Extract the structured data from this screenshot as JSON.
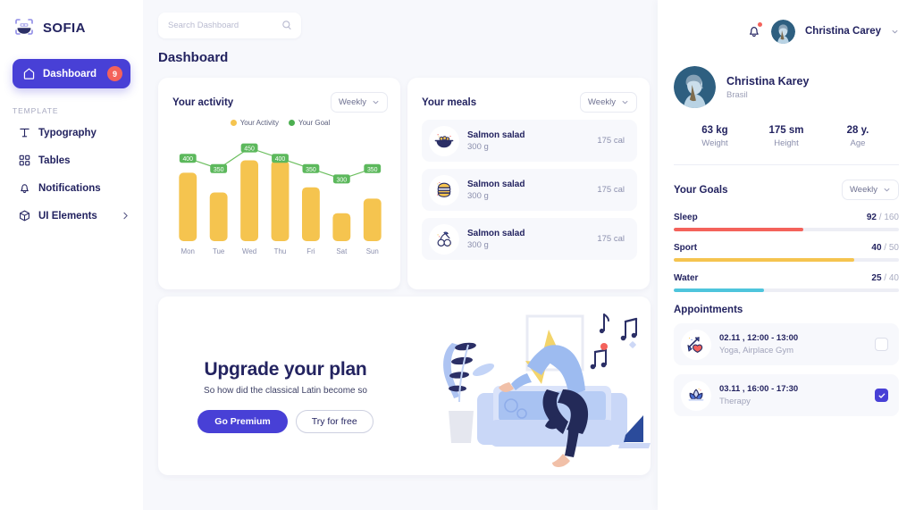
{
  "brand": {
    "name": "SOFIA",
    "logo_icon": "face-scan-icon"
  },
  "sidebar": {
    "active": {
      "label": "Dashboard",
      "badge": "9",
      "icon": "home-icon"
    },
    "section_label": "TEMPLATE",
    "items": [
      {
        "label": "Typography",
        "icon": "typography-icon"
      },
      {
        "label": "Tables",
        "icon": "tables-icon"
      },
      {
        "label": "Notifications",
        "icon": "bell-icon"
      },
      {
        "label": "UI Elements",
        "icon": "cube-icon",
        "chevron": "chevron-right-icon"
      }
    ]
  },
  "topbar": {
    "search_placeholder": "Search Dashboard",
    "search_value": "",
    "search_icon": "search-icon",
    "bell_icon": "bell-icon",
    "user_name": "Christina Carey",
    "chevron": "chevron-down-icon"
  },
  "page": {
    "title": "Dashboard"
  },
  "activity": {
    "title": "Your activity",
    "range": "Weekly",
    "legend": [
      {
        "label": "Your Activity",
        "color": "#f5c44f"
      },
      {
        "label": "Your Goal",
        "color": "#4caf50"
      }
    ]
  },
  "chart_data": {
    "type": "bar",
    "title": "Your activity",
    "categories": [
      "Mon",
      "Tue",
      "Wed",
      "Thu",
      "Fri",
      "Sat",
      "Sun"
    ],
    "xlabel": "",
    "ylabel": "",
    "ylim": [
      0,
      500
    ],
    "grid": false,
    "legend_position": "top-center",
    "series": [
      {
        "name": "Your Activity",
        "type": "bar",
        "color": "#f5c44f",
        "values": [
          330,
          235,
          390,
          390,
          260,
          135,
          205
        ]
      },
      {
        "name": "Your Goal",
        "type": "line",
        "color": "#4caf50",
        "values": [
          400,
          350,
          450,
          400,
          350,
          300,
          350
        ],
        "point_labels": [
          "400",
          "350",
          "450",
          "400",
          "350",
          "300",
          "350"
        ]
      }
    ]
  },
  "meals": {
    "title": "Your meals",
    "range": "Weekly",
    "items": [
      {
        "name": "Salmon salad",
        "weight": "300 g",
        "calories": "175 cal",
        "icon": "salad-bowl-icon"
      },
      {
        "name": "Salmon salad",
        "weight": "300 g",
        "calories": "175 cal",
        "icon": "burger-icon"
      },
      {
        "name": "Salmon salad",
        "weight": "300 g",
        "calories": "175 cal",
        "icon": "cherries-icon"
      }
    ]
  },
  "promo": {
    "title": "Upgrade your plan",
    "subtitle": "So how did the classical Latin become so",
    "primary_button": "Go Premium",
    "secondary_button": "Try for free",
    "illustration": "person-dancing-illustration"
  },
  "profile": {
    "name": "Christina Karey",
    "country": "Brasil",
    "avatar": "user-avatar",
    "stats": [
      {
        "value": "63 kg",
        "label": "Weight"
      },
      {
        "value": "175 sm",
        "label": "Height"
      },
      {
        "value": "28 y.",
        "label": "Age"
      }
    ]
  },
  "goals": {
    "title": "Your Goals",
    "range": "Weekly",
    "items": [
      {
        "name": "Sleep",
        "current": "92",
        "separator": " / ",
        "target": "160",
        "percent": 57.5,
        "color": "#f4625b"
      },
      {
        "name": "Sport",
        "current": "40",
        "separator": " / ",
        "target": "50",
        "percent": 80,
        "color": "#f5c44f"
      },
      {
        "name": "Water",
        "current": "25",
        "separator": " / ",
        "target": "40",
        "percent": 40,
        "color": "#4ec5dc"
      }
    ]
  },
  "appointments": {
    "title": "Appointments",
    "items": [
      {
        "time": "02.11 , 12:00 - 13:00",
        "desc": "Yoga, Airplace Gym",
        "checked": false,
        "icon": "heart-arrow-icon"
      },
      {
        "time": "03.11 , 16:00 - 17:30",
        "desc": "Therapy",
        "checked": true,
        "icon": "lotus-icon"
      }
    ]
  },
  "colors": {
    "accent": "#4840d6",
    "danger": "#f4625b",
    "warning": "#f5c44f",
    "success": "#4caf50",
    "info": "#4ec5dc",
    "text": "#232360",
    "muted": "#8b8fad",
    "bg": "#f7f8fc"
  }
}
